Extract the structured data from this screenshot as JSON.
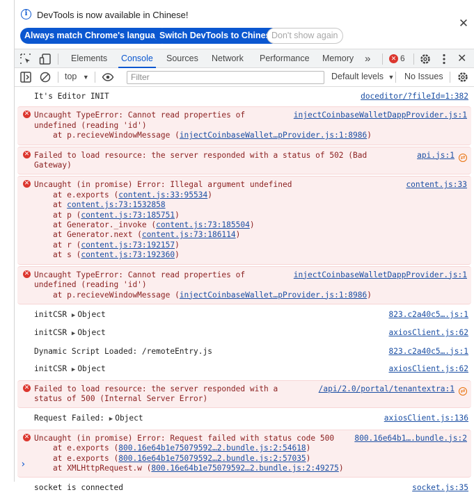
{
  "infobar": {
    "message": "DevTools is now available in Chinese!",
    "buttons": [
      "Always match Chrome's language",
      "Switch DevTools to Chinese",
      "Don't show again"
    ],
    "close_icon": "close-icon"
  },
  "tabs": {
    "items": [
      "Elements",
      "Console",
      "Sources",
      "Network",
      "Performance",
      "Memory"
    ],
    "active": "Console",
    "more": "»",
    "error_count": "6",
    "error_badge_icon": "error-icon"
  },
  "toolbar": {
    "context": "top",
    "filter_placeholder": "Filter",
    "levels": "Default levels",
    "issues": "No Issues"
  },
  "messages": [
    {
      "type": "info",
      "text": "It's Editor INIT",
      "source": "doceditor/?fileId=1:382"
    },
    {
      "type": "error",
      "text": "Uncaught TypeError: Cannot read properties of\nundefined (reading 'id')",
      "source": "injectCoinbaseWalletDappProvider.js:1",
      "stack": [
        {
          "pre": "    at p.recieveWindowMessage (",
          "link": "injectCoinbaseWallet…pProvider.js:1:8986",
          "post": ")"
        }
      ]
    },
    {
      "type": "error",
      "text": "Failed to load resource: the server responded with a status of 502 (Bad\nGateway)",
      "source": "api.js:1",
      "network": true
    },
    {
      "type": "error",
      "text": "Uncaught (in promise) Error: Illegal argument undefined",
      "source": "content.js:33",
      "stack": [
        {
          "pre": "    at e.exports (",
          "link": "content.js:33:95534",
          "post": ")"
        },
        {
          "pre": "    at ",
          "link": "content.js:73:1532858",
          "post": ""
        },
        {
          "pre": "    at p (",
          "link": "content.js:73:185751",
          "post": ")"
        },
        {
          "pre": "    at Generator._invoke (",
          "link": "content.js:73:185504",
          "post": ")"
        },
        {
          "pre": "    at Generator.next (",
          "link": "content.js:73:186114",
          "post": ")"
        },
        {
          "pre": "    at r (",
          "link": "content.js:73:192157",
          "post": ")"
        },
        {
          "pre": "    at s (",
          "link": "content.js:73:192360",
          "post": ")"
        }
      ]
    },
    {
      "type": "error",
      "text": "Uncaught TypeError: Cannot read properties of\nundefined (reading 'id')",
      "source": "injectCoinbaseWalletDappProvider.js:1",
      "stack": [
        {
          "pre": "    at p.recieveWindowMessage (",
          "link": "injectCoinbaseWallet…pProvider.js:1:8986",
          "post": ")"
        }
      ]
    },
    {
      "type": "info",
      "text": "initCSR ",
      "object": "Object",
      "source": "823.c2a40c5….js:1"
    },
    {
      "type": "info",
      "text": "initCSR ",
      "object": "Object",
      "source": "axiosClient.js:62"
    },
    {
      "type": "info",
      "text": "Dynamic Script Loaded: /remoteEntry.js",
      "source": "823.c2a40c5….js:1"
    },
    {
      "type": "info",
      "text": "initCSR ",
      "object": "Object",
      "source": "axiosClient.js:62"
    },
    {
      "type": "error",
      "text": "Failed to load resource: the server responded with a\nstatus of 500 (Internal Server Error)",
      "source": "/api/2.0/portal/tenantextra:1",
      "network": true
    },
    {
      "type": "info",
      "text": "Request Failed: ",
      "object": "Object",
      "source": "axiosClient.js:136"
    },
    {
      "type": "error",
      "text": "Uncaught (in promise) Error: Request failed with status code 500",
      "source": "800.16e64b1….bundle.js:2",
      "stack": [
        {
          "pre": "    at e.exports (",
          "link": "800.16e64b1e75079592…2.bundle.js:2:54618",
          "post": ")"
        },
        {
          "pre": "    at e.exports (",
          "link": "800.16e64b1e75079592…2.bundle.js:2:57035",
          "post": ")"
        },
        {
          "pre": "    at XMLHttpRequest.w (",
          "link": "800.16e64b1e75079592…2.bundle.js:2:49275",
          "post": ")"
        }
      ]
    },
    {
      "type": "info",
      "text": "socket is connected",
      "source": "socket.js:35"
    }
  ],
  "prompt": "›"
}
